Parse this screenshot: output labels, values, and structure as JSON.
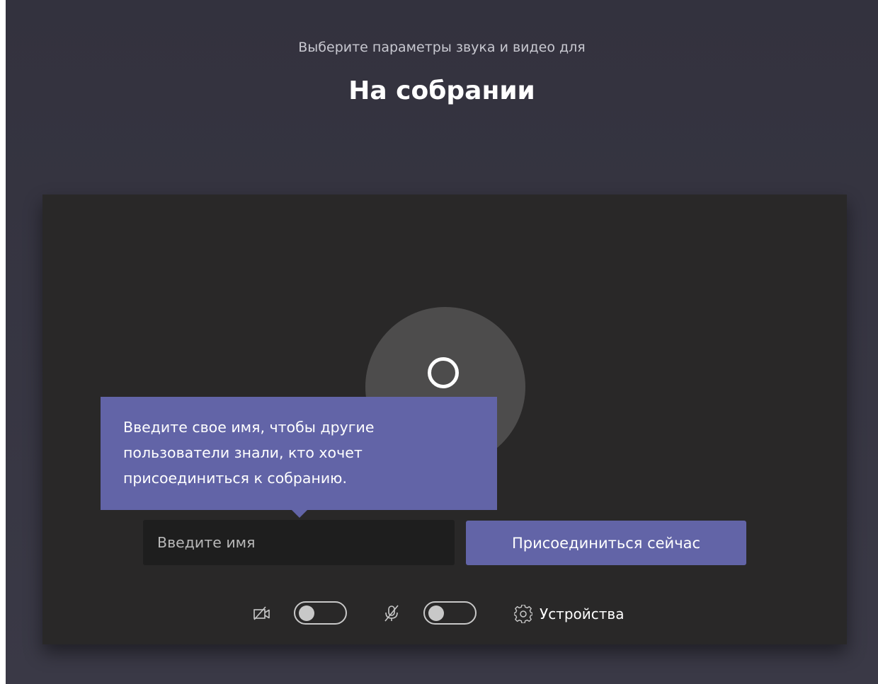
{
  "header": {
    "subtitle": "Выберите параметры звука и видео для",
    "title": "На собрании"
  },
  "tooltip": {
    "lines": [
      "Введите свое имя, чтобы другие",
      "пользователи знали, кто хочет",
      "присоединиться к собранию."
    ]
  },
  "name_input": {
    "placeholder": "Введите имя",
    "value": ""
  },
  "join_button": {
    "label": "Присоединиться сейчас"
  },
  "controls": {
    "camera_toggle": {
      "on": false,
      "icon": "camera-off-icon"
    },
    "mic_toggle": {
      "on": false,
      "icon": "mic-off-icon"
    },
    "settings": {
      "label": "Устройства",
      "icon": "gear-icon"
    }
  },
  "colors": {
    "accent": "#6264a7",
    "page_background": "#35343f",
    "stage_background": "#292828",
    "avatar_background": "#4d4c4c"
  }
}
